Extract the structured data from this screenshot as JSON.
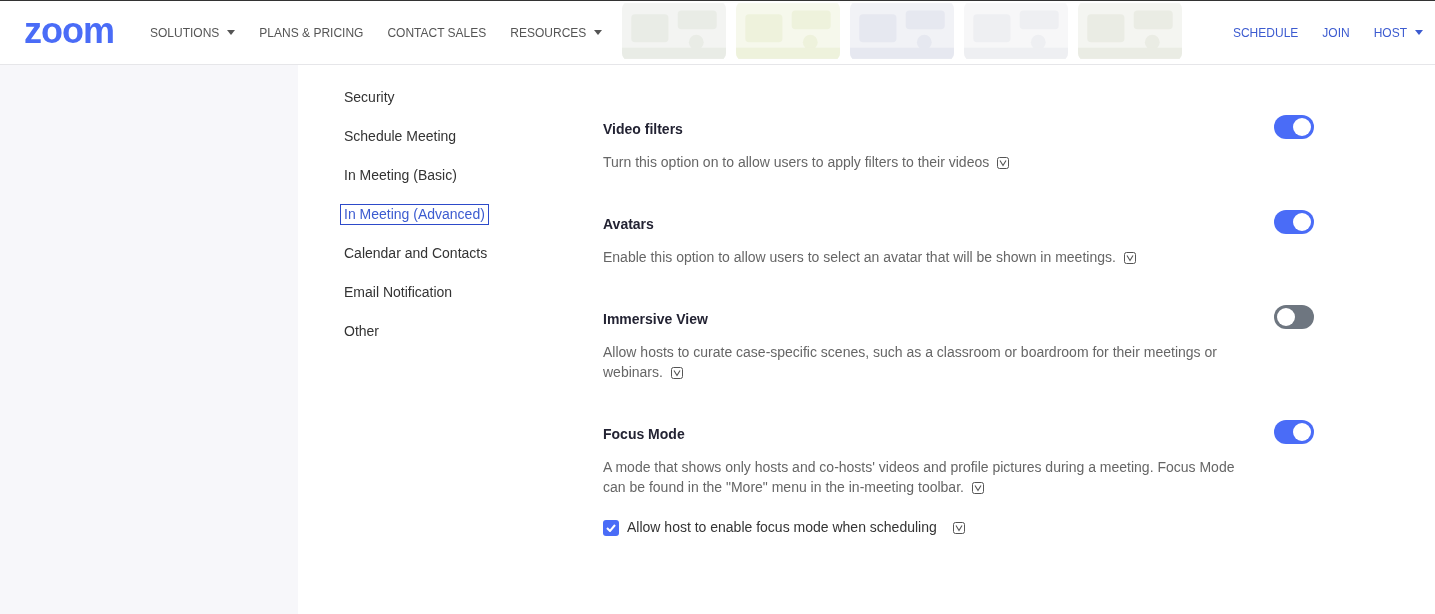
{
  "header": {
    "logo": "zoom",
    "nav": [
      {
        "label": "SOLUTIONS",
        "dropdown": true
      },
      {
        "label": "PLANS & PRICING",
        "dropdown": false
      },
      {
        "label": "CONTACT SALES",
        "dropdown": false
      },
      {
        "label": "RESOURCES",
        "dropdown": true
      }
    ],
    "actions": [
      {
        "label": "SCHEDULE",
        "dropdown": false
      },
      {
        "label": "JOIN",
        "dropdown": false
      },
      {
        "label": "HOST",
        "dropdown": true
      }
    ]
  },
  "sidebar": {
    "items": [
      {
        "label": "Security",
        "selected": false
      },
      {
        "label": "Schedule Meeting",
        "selected": false
      },
      {
        "label": "In Meeting (Basic)",
        "selected": false
      },
      {
        "label": "In Meeting (Advanced)",
        "selected": true
      },
      {
        "label": "Calendar and Contacts",
        "selected": false
      },
      {
        "label": "Email Notification",
        "selected": false
      },
      {
        "label": "Other",
        "selected": false
      }
    ]
  },
  "settings": [
    {
      "title": "Video filters",
      "description": "Turn this option on to allow users to apply filters to their videos",
      "on": true
    },
    {
      "title": "Avatars",
      "description": "Enable this option to allow users to select an avatar that will be shown in meetings.",
      "on": true
    },
    {
      "title": "Immersive View",
      "description": "Allow hosts to curate case-specific scenes, such as a classroom or boardroom for their meetings or webinars.",
      "on": false
    },
    {
      "title": "Focus Mode",
      "description": "A mode that shows only hosts and co-hosts' videos and profile pictures during a meeting. Focus Mode can be found in the \"More\" menu in the in-meeting toolbar.",
      "on": true,
      "options": [
        {
          "label": "Allow host to enable focus mode when scheduling",
          "checked": true
        }
      ]
    }
  ]
}
